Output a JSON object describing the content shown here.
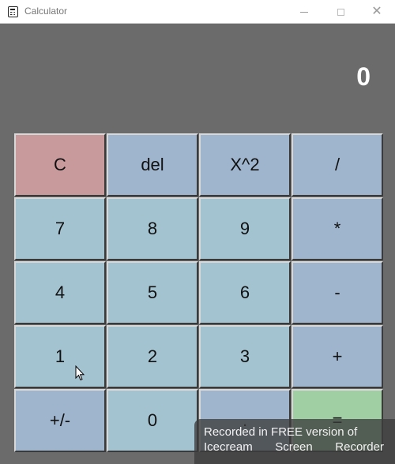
{
  "window": {
    "title": "Calculator",
    "controls": {
      "minimize": "—",
      "maximize": "□",
      "close": "✕"
    }
  },
  "display": {
    "value": "0"
  },
  "keypad": {
    "rows": [
      [
        {
          "label": "C",
          "color": "#c99a9c"
        },
        {
          "label": "del",
          "color": "#9fb5cd"
        },
        {
          "label": "X^2",
          "color": "#9fb5cd"
        },
        {
          "label": "/",
          "color": "#9fb5cd"
        }
      ],
      [
        {
          "label": "7",
          "color": "#a4c3d1"
        },
        {
          "label": "8",
          "color": "#a4c3d1"
        },
        {
          "label": "9",
          "color": "#a4c3d1"
        },
        {
          "label": "*",
          "color": "#9fb5cd"
        }
      ],
      [
        {
          "label": "4",
          "color": "#a4c3d1"
        },
        {
          "label": "5",
          "color": "#a4c3d1"
        },
        {
          "label": "6",
          "color": "#a4c3d1"
        },
        {
          "label": "-",
          "color": "#9fb5cd"
        }
      ],
      [
        {
          "label": "1",
          "color": "#a4c3d1"
        },
        {
          "label": "2",
          "color": "#a4c3d1"
        },
        {
          "label": "3",
          "color": "#a4c3d1"
        },
        {
          "label": "+",
          "color": "#9fb5cd"
        }
      ],
      [
        {
          "label": "+/-",
          "color": "#9fb5cd"
        },
        {
          "label": "0",
          "color": "#a4c3d1"
        },
        {
          "label": ".",
          "color": "#9fb5cd"
        },
        {
          "label": "=",
          "color": "#9fcfa3"
        }
      ]
    ]
  },
  "watermark": {
    "line1": "Recorded in FREE version of",
    "line2": [
      "Icecream",
      "Screen",
      "Recorder"
    ]
  },
  "colors": {
    "background": "#6b6b6b",
    "display_text": "#ffffff"
  }
}
